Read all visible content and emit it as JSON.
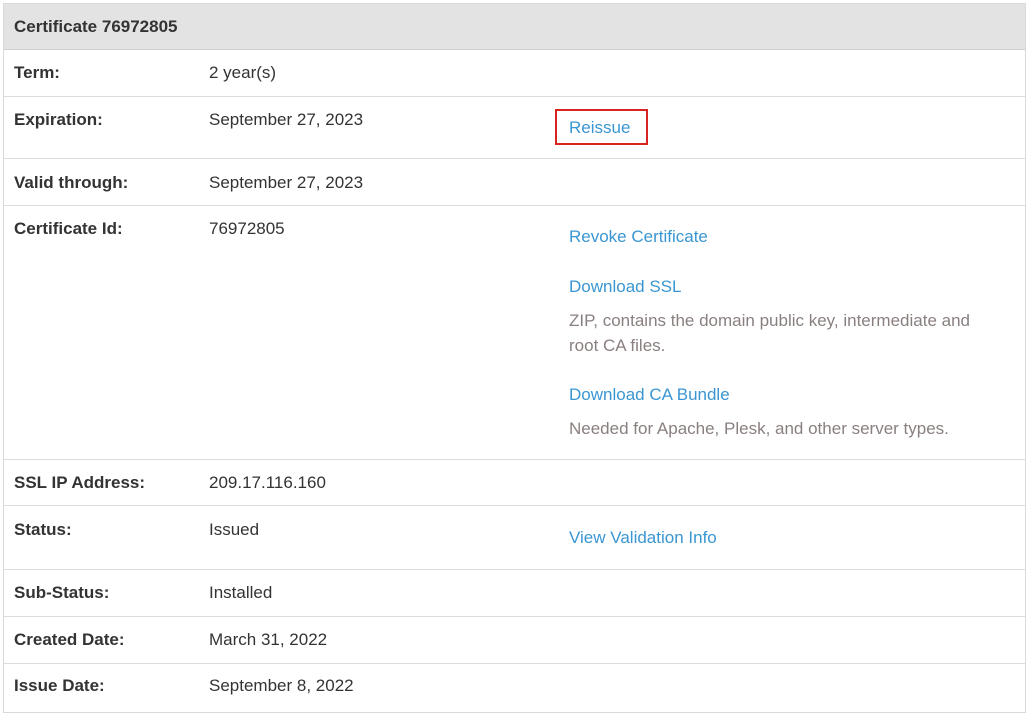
{
  "header": {
    "title": "Certificate 76972805"
  },
  "rows": {
    "term": {
      "label": "Term:",
      "value": "2 year(s)"
    },
    "expiration": {
      "label": "Expiration:",
      "value": "September 27, 2023",
      "action": "Reissue"
    },
    "valid_through": {
      "label": "Valid through:",
      "value": "September 27, 2023"
    },
    "certificate_id": {
      "label": "Certificate Id:",
      "value": "76972805",
      "revoke": "Revoke Certificate",
      "download_ssl": "Download SSL",
      "download_ssl_note": "ZIP, contains the domain public key, intermediate and root CA files.",
      "download_ca": "Download CA Bundle",
      "download_ca_note": "Needed for Apache, Plesk, and other server types."
    },
    "ssl_ip": {
      "label": "SSL IP Address:",
      "value": "209.17.116.160"
    },
    "status": {
      "label": "Status:",
      "value": "Issued",
      "action": "View Validation Info"
    },
    "sub_status": {
      "label": "Sub-Status:",
      "value": "Installed"
    },
    "created_date": {
      "label": "Created Date:",
      "value": "March 31, 2022"
    },
    "issue_date": {
      "label": "Issue Date:",
      "value": "September 8, 2022"
    }
  },
  "colors": {
    "link": "#3a96d2",
    "highlight": "#d9231f",
    "header_bg": "#e3e3e3",
    "note": "#8a7f7f"
  }
}
